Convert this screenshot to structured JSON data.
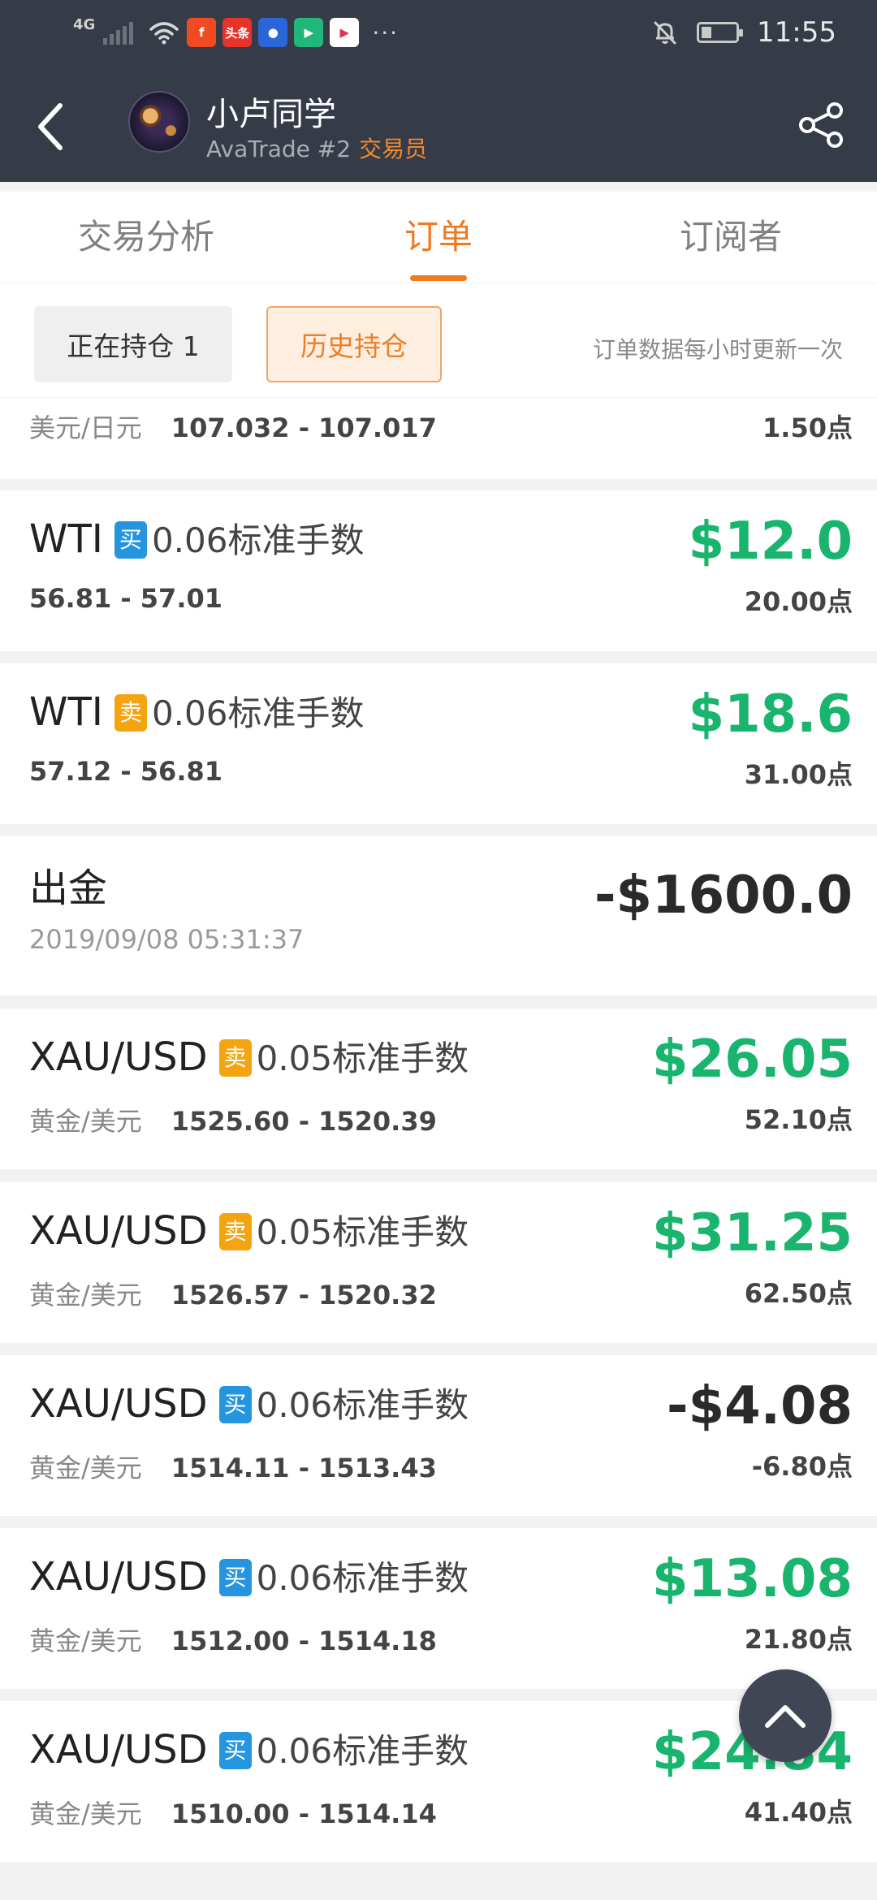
{
  "status_bar": {
    "network": "4G",
    "time": "11:55",
    "apps": [
      {
        "name": "app-icon-red-f",
        "label": "f",
        "color": "#f04a23"
      },
      {
        "name": "app-icon-toutiao",
        "label": "头条",
        "color": "#e8332b"
      },
      {
        "name": "app-icon-baidu",
        "label": "●",
        "color": "#2a66d9"
      },
      {
        "name": "app-icon-play",
        "label": "▶",
        "color": "#1fb87a"
      },
      {
        "name": "app-icon-youku",
        "label": "▶",
        "color": "#ffffff"
      }
    ],
    "more": "···"
  },
  "header": {
    "trader_name": "小卢同学",
    "broker": "AvaTrade #2",
    "role": "交易员"
  },
  "tabs": [
    "交易分析",
    "订单",
    "订阅者"
  ],
  "active_tab": "订单",
  "filters": {
    "open_positions": "正在持仓 1",
    "history": "历史持仓",
    "note": "订单数据每小时更新一次"
  },
  "orders": [
    {
      "partial": true,
      "pair": "美元/日元",
      "range": "107.032 - 107.017",
      "points": "1.50点"
    },
    {
      "symbol": "WTI",
      "side": "买",
      "lots": "0.06标准手数",
      "pair": "",
      "range": "56.81 - 57.01",
      "profit": "$12.0",
      "points": "20.00点"
    },
    {
      "symbol": "WTI",
      "side": "卖",
      "lots": "0.06标准手数",
      "pair": "",
      "range": "57.12 - 56.81",
      "profit": "$18.6",
      "points": "31.00点"
    },
    {
      "withdrawal": true,
      "title": "出金",
      "time": "2019/09/08 05:31:37",
      "amount": "-$1600.0"
    },
    {
      "symbol": "XAU/USD",
      "side": "卖",
      "lots": "0.05标准手数",
      "pair": "黄金/美元",
      "range": "1525.60 - 1520.39",
      "profit": "$26.05",
      "points": "52.10点"
    },
    {
      "symbol": "XAU/USD",
      "side": "卖",
      "lots": "0.05标准手数",
      "pair": "黄金/美元",
      "range": "1526.57 - 1520.32",
      "profit": "$31.25",
      "points": "62.50点"
    },
    {
      "symbol": "XAU/USD",
      "side": "买",
      "lots": "0.06标准手数",
      "pair": "黄金/美元",
      "range": "1514.11 - 1513.43",
      "profit": "-$4.08",
      "points": "-6.80点"
    },
    {
      "symbol": "XAU/USD",
      "side": "买",
      "lots": "0.06标准手数",
      "pair": "黄金/美元",
      "range": "1512.00 - 1514.18",
      "profit": "$13.08",
      "points": "21.80点"
    },
    {
      "symbol": "XAU/USD",
      "side": "买",
      "lots": "0.06标准手数",
      "pair": "黄金/美元",
      "range": "1510.00 - 1514.14",
      "profit": "$24.84",
      "points": "41.40点"
    }
  ],
  "colors": {
    "header_bg": "#363c47",
    "accent": "#f07a21",
    "profit_green": "#19b46e",
    "buy_badge": "#2595e0",
    "sell_badge": "#f5a411"
  }
}
